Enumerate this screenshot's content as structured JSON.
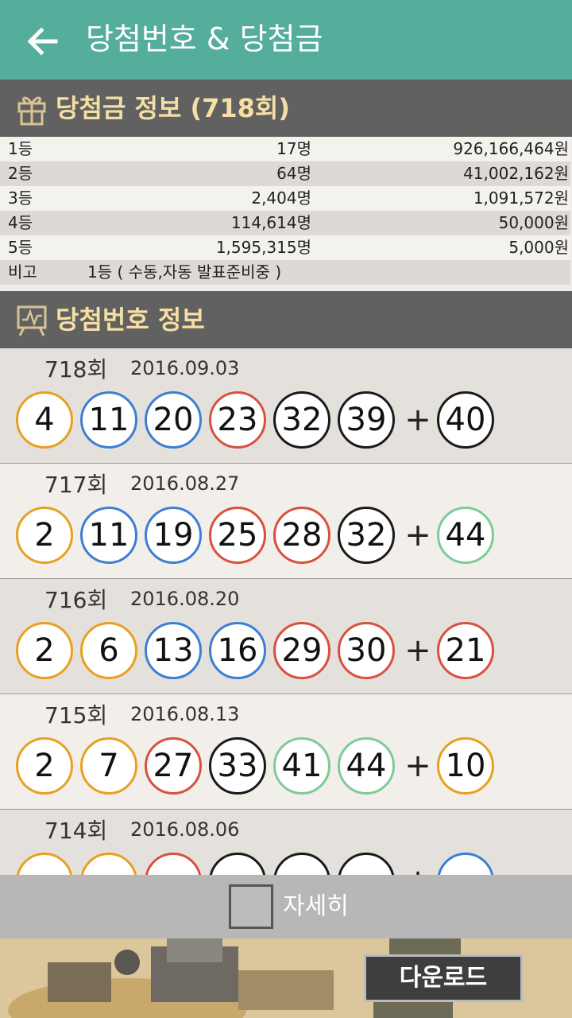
{
  "appbar": {
    "title": "당첨번호 & 당첨금"
  },
  "prize_section": {
    "title": "당첨금 정보 (718회)",
    "rows": [
      {
        "rank": "1등",
        "count": "17명",
        "amount": "926,166,464원"
      },
      {
        "rank": "2등",
        "count": "64명",
        "amount": "41,002,162원"
      },
      {
        "rank": "3등",
        "count": "2,404명",
        "amount": "1,091,572원"
      },
      {
        "rank": "4등",
        "count": "114,614명",
        "amount": "50,000원"
      },
      {
        "rank": "5등",
        "count": "1,595,315명",
        "amount": "5,000원"
      }
    ],
    "note_label": "비고",
    "note_text": "1등 ( 수동,자동 발표준비중 )"
  },
  "numbers_section": {
    "title": "당첨번호 정보"
  },
  "ball_colors": {
    "yellow": "#e8a020",
    "blue": "#3a7fd5",
    "red": "#d9503f",
    "black": "#1a1a1a",
    "green": "#7ccb98"
  },
  "draws": [
    {
      "round": "718회",
      "date": "2016.09.03",
      "numbers": [
        {
          "n": "4",
          "c": "yellow"
        },
        {
          "n": "11",
          "c": "blue"
        },
        {
          "n": "20",
          "c": "blue"
        },
        {
          "n": "23",
          "c": "red"
        },
        {
          "n": "32",
          "c": "black"
        },
        {
          "n": "39",
          "c": "black"
        }
      ],
      "bonus": {
        "n": "40",
        "c": "black"
      }
    },
    {
      "round": "717회",
      "date": "2016.08.27",
      "numbers": [
        {
          "n": "2",
          "c": "yellow"
        },
        {
          "n": "11",
          "c": "blue"
        },
        {
          "n": "19",
          "c": "blue"
        },
        {
          "n": "25",
          "c": "red"
        },
        {
          "n": "28",
          "c": "red"
        },
        {
          "n": "32",
          "c": "black"
        }
      ],
      "bonus": {
        "n": "44",
        "c": "green"
      }
    },
    {
      "round": "716회",
      "date": "2016.08.20",
      "numbers": [
        {
          "n": "2",
          "c": "yellow"
        },
        {
          "n": "6",
          "c": "yellow"
        },
        {
          "n": "13",
          "c": "blue"
        },
        {
          "n": "16",
          "c": "blue"
        },
        {
          "n": "29",
          "c": "red"
        },
        {
          "n": "30",
          "c": "red"
        }
      ],
      "bonus": {
        "n": "21",
        "c": "red"
      }
    },
    {
      "round": "715회",
      "date": "2016.08.13",
      "numbers": [
        {
          "n": "2",
          "c": "yellow"
        },
        {
          "n": "7",
          "c": "yellow"
        },
        {
          "n": "27",
          "c": "red"
        },
        {
          "n": "33",
          "c": "black"
        },
        {
          "n": "41",
          "c": "green"
        },
        {
          "n": "44",
          "c": "green"
        }
      ],
      "bonus": {
        "n": "10",
        "c": "yellow"
      }
    },
    {
      "round": "714회",
      "date": "2016.08.06",
      "numbers": [
        {
          "n": "",
          "c": "yellow"
        },
        {
          "n": "",
          "c": "yellow"
        },
        {
          "n": "",
          "c": "red"
        },
        {
          "n": "",
          "c": "black"
        },
        {
          "n": "",
          "c": "black"
        },
        {
          "n": "",
          "c": "black"
        }
      ],
      "bonus": {
        "n": "",
        "c": "blue"
      }
    }
  ],
  "footer": {
    "checkbox_label": "자세히"
  },
  "ad": {
    "button_label": "다운로드"
  }
}
